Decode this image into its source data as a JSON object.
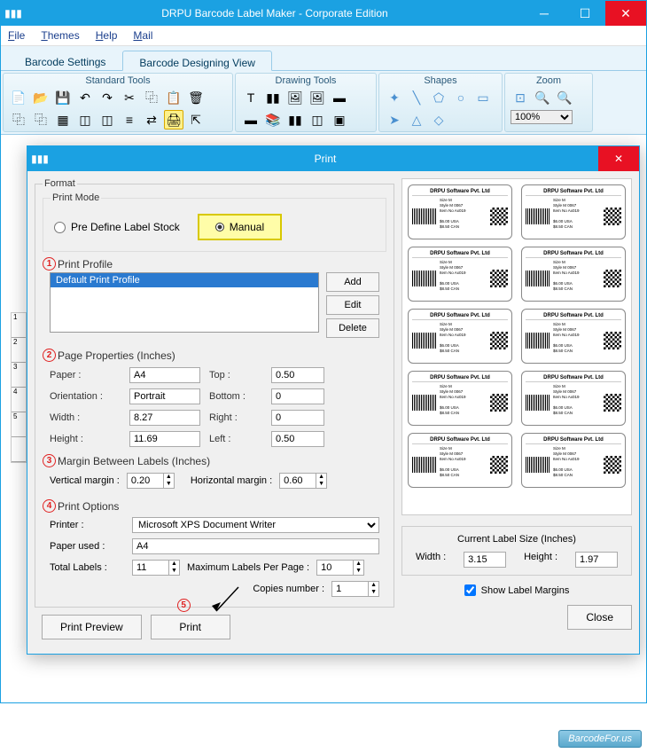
{
  "window": {
    "title": "DRPU Barcode Label Maker - Corporate Edition",
    "menu": [
      "File",
      "Themes",
      "Help",
      "Mail"
    ],
    "tabs": [
      "Barcode Settings",
      "Barcode Designing View"
    ],
    "active_tab": 1
  },
  "ribbon": {
    "groups": [
      {
        "title": "Standard Tools"
      },
      {
        "title": "Drawing Tools"
      },
      {
        "title": "Shapes"
      },
      {
        "title": "Zoom",
        "zoom_value": "100%"
      }
    ]
  },
  "print_dialog": {
    "title": "Print",
    "format_legend": "Format",
    "print_mode_legend": "Print Mode",
    "predefine_label": "Pre Define Label Stock",
    "manual_label": "Manual",
    "sections": {
      "profile": {
        "num": "1",
        "title": "Print Profile",
        "item": "Default Print Profile",
        "btn_add": "Add",
        "btn_edit": "Edit",
        "btn_delete": "Delete"
      },
      "page": {
        "num": "2",
        "title": "Page Properties (Inches)",
        "paper_lbl": "Paper :",
        "paper": "A4",
        "orient_lbl": "Orientation :",
        "orient": "Portrait",
        "width_lbl": "Width :",
        "width": "8.27",
        "height_lbl": "Height :",
        "height": "11.69",
        "top_lbl": "Top :",
        "top": "0.50",
        "bottom_lbl": "Bottom :",
        "bottom": "0",
        "right_lbl": "Right :",
        "right": "0",
        "left_lbl": "Left :",
        "left": "0.50"
      },
      "margin": {
        "num": "3",
        "title": "Margin Between Labels (Inches)",
        "v_lbl": "Vertical margin :",
        "v": "0.20",
        "h_lbl": "Horizontal margin :",
        "h": "0.60"
      },
      "options": {
        "num": "4",
        "title": "Print Options",
        "printer_lbl": "Printer :",
        "printer": "Microsoft XPS Document Writer",
        "paper_used_lbl": "Paper used :",
        "paper_used": "A4",
        "total_lbl": "Total Labels :",
        "total": "11",
        "max_lbl": "Maximum Labels Per Page :",
        "max": "10",
        "copies_lbl": "Copies number :",
        "copies": "1"
      },
      "step5": "5"
    },
    "btn_preview": "Print Preview",
    "btn_print": "Print",
    "btn_close": "Close",
    "current_size": {
      "title": "Current Label Size (Inches)",
      "w_lbl": "Width :",
      "w": "3.15",
      "h_lbl": "Height :",
      "h": "1.97"
    },
    "show_margins": "Show Label Margins",
    "label_preview": {
      "company": "DRPU Software Pvt. Ltd",
      "line1": "Size    M",
      "line2": "Style   M 0067",
      "line3": "Item No   Ax019",
      "line4": "$6.00  USA",
      "line5": "$8.50  CAN"
    }
  },
  "watermark": "BarcodeFor.us"
}
